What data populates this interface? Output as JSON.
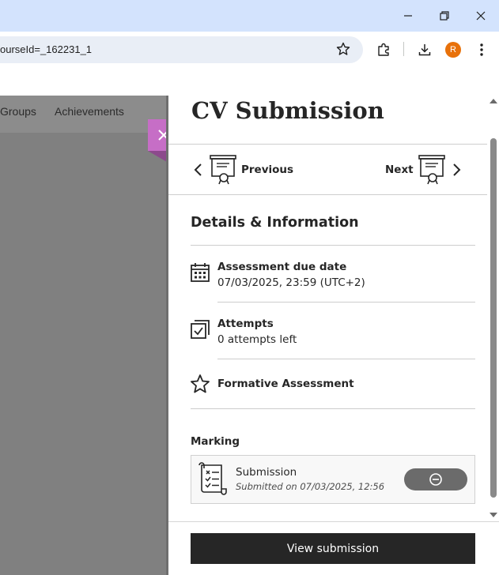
{
  "browser": {
    "url": "ourseId=_162231_1",
    "profile_initial": "R",
    "colors": {
      "titlebar": "#d3e3fd",
      "omnibox": "#e9eef6",
      "avatar": "#e8710a"
    }
  },
  "page_nav": {
    "items": [
      "Groups",
      "Achievements"
    ]
  },
  "panel": {
    "title": "CV Submission",
    "previous_label": "Previous",
    "next_label": "Next",
    "section_heading": "Details & Information",
    "details": [
      {
        "icon": "calendar-icon",
        "title": "Assessment due date",
        "value": "07/03/2025, 23:59 (UTC+2)"
      },
      {
        "icon": "attempts-icon",
        "title": "Attempts",
        "value": "0 attempts left"
      },
      {
        "icon": "star-icon",
        "title": "Formative Assessment"
      }
    ],
    "marking": {
      "label": "Marking",
      "submission_title": "Submission",
      "submission_meta": "Submitted on 07/03/2025, 12:56",
      "status_icon": "minus-circle-icon"
    },
    "view_button_label": "View submission",
    "colors": {
      "close_tab": "#c66ec6",
      "primary_button": "#262626",
      "status_pill": "#6b6b6b"
    }
  }
}
